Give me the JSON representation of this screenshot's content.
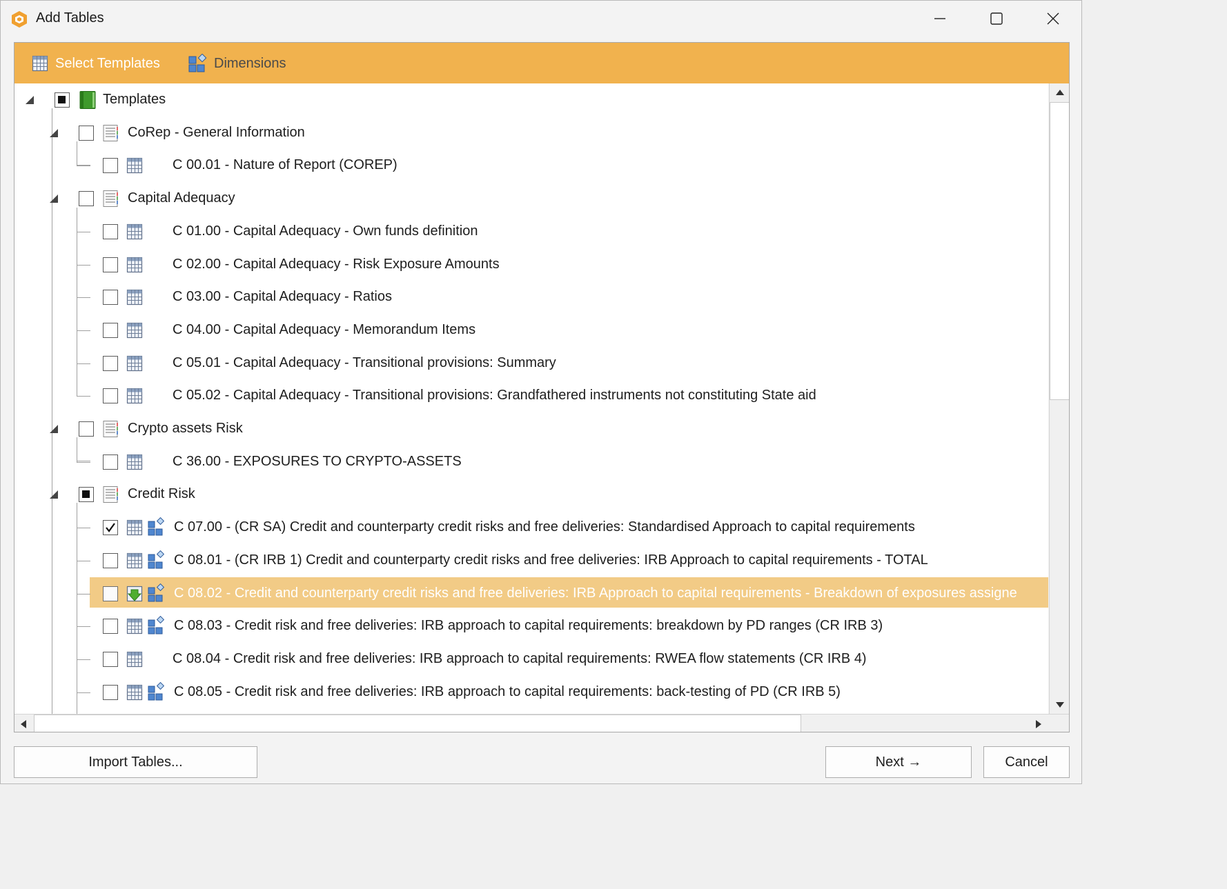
{
  "window": {
    "title": "Add Tables",
    "controls": [
      "minimize-icon",
      "maximize-icon",
      "close-icon"
    ]
  },
  "toolbar": {
    "select_templates": "Select Templates",
    "dimensions": "Dimensions",
    "active_color": "#f1b24e"
  },
  "tree": {
    "root": {
      "label": "Templates",
      "state": "partial"
    },
    "groups": [
      {
        "label": "CoRep - General Information",
        "state": "unchecked",
        "items": [
          {
            "label": "C 00.01 - Nature of Report (COREP)",
            "state": "unchecked"
          }
        ]
      },
      {
        "label": "Capital Adequacy",
        "state": "unchecked",
        "items": [
          {
            "label": "C 01.00 - Capital Adequacy - Own funds definition",
            "state": "unchecked"
          },
          {
            "label": "C 02.00 - Capital Adequacy - Risk Exposure Amounts",
            "state": "unchecked"
          },
          {
            "label": "C 03.00 - Capital Adequacy - Ratios",
            "state": "unchecked"
          },
          {
            "label": "C 04.00 - Capital Adequacy - Memorandum Items",
            "state": "unchecked"
          },
          {
            "label": "C 05.01 - Capital Adequacy - Transitional provisions: Summary",
            "state": "unchecked"
          },
          {
            "label": "C 05.02 - Capital Adequacy - Transitional provisions: Grandfathered instruments not constituting State aid",
            "state": "unchecked"
          }
        ]
      },
      {
        "label": "Crypto assets Risk",
        "state": "unchecked",
        "items": [
          {
            "label": "C 36.00 - EXPOSURES TO CRYPTO-ASSETS",
            "state": "unchecked"
          }
        ]
      },
      {
        "label": "Credit Risk",
        "state": "partial",
        "items": [
          {
            "label": "C 07.00 - (CR SA) Credit and counterparty credit risks and free deliveries: Standardised Approach to capital requirements",
            "state": "checked",
            "dims": true
          },
          {
            "label": "C 08.01 - (CR IRB 1) Credit and counterparty credit risks and free deliveries: IRB Approach to capital requirements - TOTAL",
            "state": "unchecked",
            "dims": true
          },
          {
            "label": "C 08.02 - Credit and counterparty credit risks and free deliveries: IRB Approach to capital requirements - Breakdown of exposures assigne",
            "state": "unchecked",
            "dims": true,
            "selected": true
          },
          {
            "label": "C 08.03 - Credit risk and free deliveries: IRB approach to capital requirements: breakdown by PD ranges  (CR IRB 3)",
            "state": "unchecked",
            "dims": true
          },
          {
            "label": "C 08.04 - Credit risk and free deliveries: IRB approach to capital requirements: RWEA flow statements (CR IRB 4)",
            "state": "unchecked"
          },
          {
            "label": "C 08.05 - Credit risk and free deliveries: IRB approach to capital requirements: back-testing of PD (CR IRB 5)",
            "state": "unchecked",
            "dims": true
          }
        ]
      }
    ],
    "selection_color": "#f2cb86"
  },
  "buttons": {
    "import": "Import Tables...",
    "next": "Next →",
    "cancel": "Cancel"
  }
}
